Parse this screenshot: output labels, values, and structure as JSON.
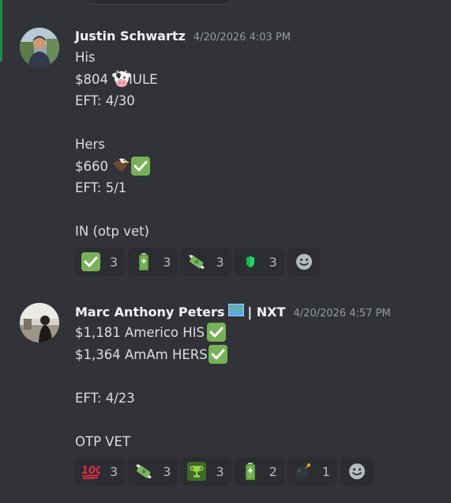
{
  "messages": [
    {
      "author": "Justin Schwartz",
      "timestamp": "4/20/2026 4:03 PM",
      "lines": {
        "l1": "His",
        "l2_amount": "$804",
        "l2_suffix": "IULE",
        "l3": "EFT: 4/30",
        "l5": "Hers",
        "l6_amount": "$660",
        "l7": "EFT: 5/1",
        "l9": "IN (otp vet)"
      },
      "reactions": [
        {
          "icon": "check-mark-icon",
          "count": "3"
        },
        {
          "icon": "battery-icon",
          "count": "3"
        },
        {
          "icon": "money-with-wings-icon",
          "count": "3"
        },
        {
          "icon": "shield-icon",
          "count": "3"
        }
      ]
    },
    {
      "author": "Marc Anthony Peters",
      "author_suffix": "| NXT",
      "timestamp": "4/20/2026 4:57 PM",
      "lines": {
        "l1": "$1,181 Americo HIS",
        "l2": "$1,364 AmAm HERS",
        "l4": "EFT: 4/23",
        "l6": "OTP VET"
      },
      "reactions": [
        {
          "icon": "hundred-points-icon",
          "count": "3"
        },
        {
          "icon": "money-with-wings-icon",
          "count": "3"
        },
        {
          "icon": "trophy-icon",
          "count": "3"
        },
        {
          "icon": "battery-icon",
          "count": "2"
        },
        {
          "icon": "bomb-icon",
          "count": "1"
        }
      ]
    }
  ],
  "colors": {
    "background": "#313338",
    "reaction_bg": "#2b2d31",
    "check_green": "#78b159",
    "timestamp": "#949ba4",
    "username": "#f2f3f5"
  }
}
